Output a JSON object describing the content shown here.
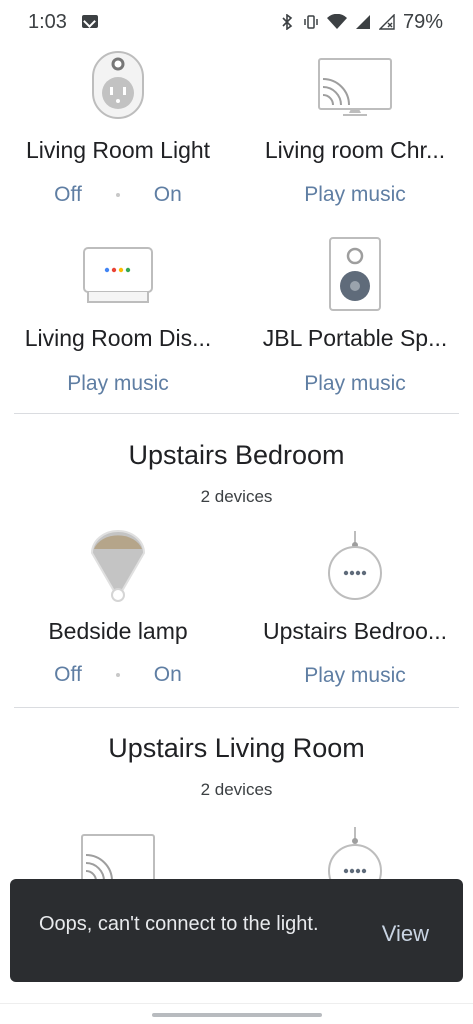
{
  "status_bar": {
    "time": "1:03",
    "battery": "79%"
  },
  "devices_top": [
    {
      "name": "Living Room Light",
      "off": "Off",
      "on": "On"
    },
    {
      "name": "Living room Chr...",
      "action": "Play music"
    },
    {
      "name": "Living Room Dis...",
      "action": "Play music"
    },
    {
      "name": "JBL Portable Sp...",
      "action": "Play music"
    }
  ],
  "rooms": [
    {
      "title": "Upstairs Bedroom",
      "count": "2 devices",
      "devices": [
        {
          "name": "Bedside lamp",
          "off": "Off",
          "on": "On"
        },
        {
          "name": "Upstairs Bedroo...",
          "action": "Play music"
        }
      ]
    },
    {
      "title": "Upstairs Living Room",
      "count": "2 devices"
    }
  ],
  "snackbar": {
    "message": "Oops, can't connect to the light.",
    "action": "View"
  },
  "colors": {
    "action_text": "#5f7ea3",
    "snackbar_bg": "#2b2d30"
  }
}
